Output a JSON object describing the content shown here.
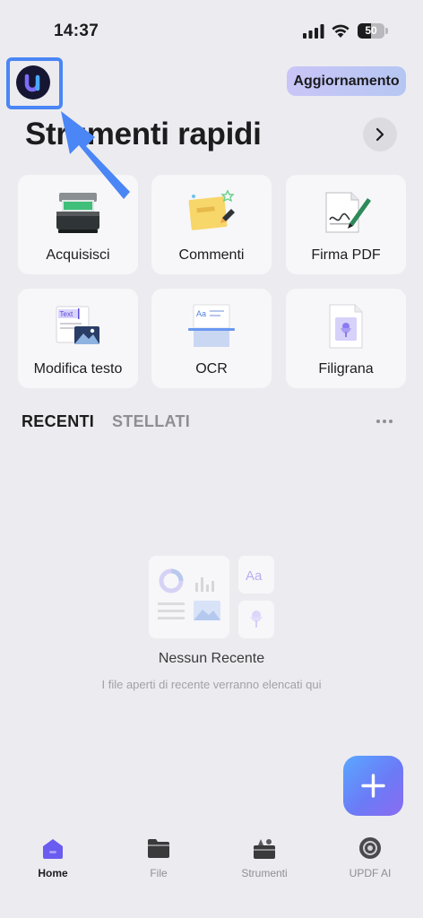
{
  "status_bar": {
    "time": "14:37",
    "battery_level": "50"
  },
  "header": {
    "update_label": "Aggiornamento",
    "section_title": "Strumenti rapidi"
  },
  "tools": [
    {
      "label": "Acquisisci",
      "icon": "scanner-icon"
    },
    {
      "label": "Commenti",
      "icon": "sticky-note-icon"
    },
    {
      "label": "Firma PDF",
      "icon": "signature-icon"
    },
    {
      "label": "Modifica testo",
      "icon": "edit-text-icon"
    },
    {
      "label": "OCR",
      "icon": "ocr-icon"
    },
    {
      "label": "Filigrana",
      "icon": "watermark-icon"
    }
  ],
  "tabs": {
    "recent": "RECENTI",
    "starred": "STELLATI"
  },
  "empty_state": {
    "title": "Nessun Recente",
    "subtitle": "I file aperti di recente verranno elencati qui"
  },
  "bottom_nav": [
    {
      "label": "Home",
      "icon": "home-icon",
      "active": true
    },
    {
      "label": "File",
      "icon": "folder-icon",
      "active": false
    },
    {
      "label": "Strumenti",
      "icon": "toolbox-icon",
      "active": false
    },
    {
      "label": "UPDF AI",
      "icon": "ai-icon",
      "active": false
    }
  ],
  "colors": {
    "background": "#ececf0",
    "accent": "#6b7bf7",
    "highlight": "#4a86f5",
    "nav_active": "#6a5cf0"
  }
}
